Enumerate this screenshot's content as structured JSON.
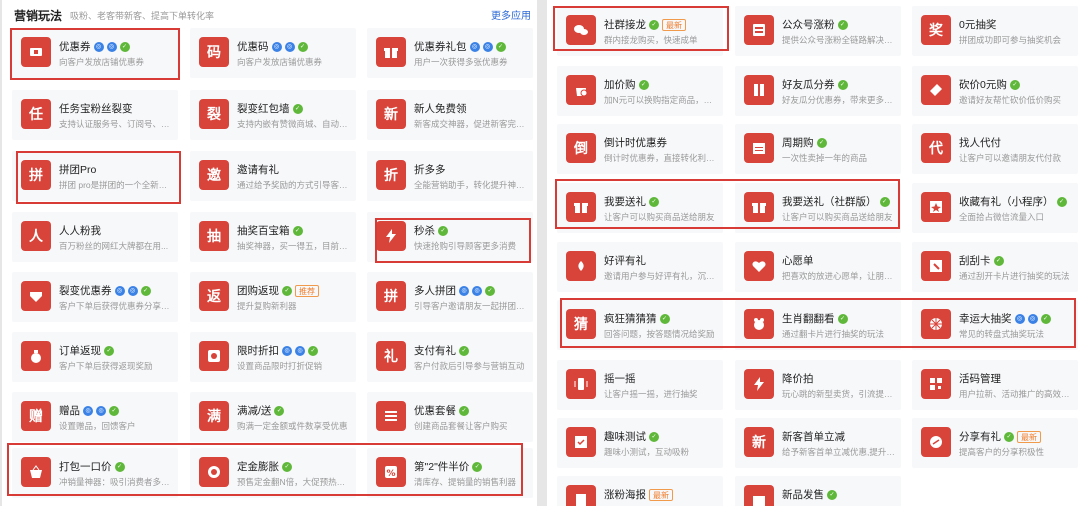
{
  "left": {
    "title": "营销玩法",
    "subtitle": "吸粉、老客带新客、提高下单转化率",
    "more": "更多应用",
    "cards": [
      {
        "name": "优惠券",
        "desc": "向客户发放店铺优惠券",
        "icon": "ticket-icon",
        "glyph": "",
        "badges": [
          "blue",
          "blue",
          "green"
        ],
        "tag": ""
      },
      {
        "name": "优惠码",
        "desc": "向客户发放店铺优惠券",
        "icon": "code-icon",
        "glyph": "码",
        "badges": [
          "blue",
          "blue",
          "green"
        ],
        "tag": ""
      },
      {
        "name": "优惠券礼包",
        "desc": "用户一次获得多张优惠券",
        "icon": "gift-pack-icon",
        "glyph": "",
        "badges": [
          "blue",
          "blue",
          "green"
        ],
        "tag": ""
      },
      {
        "name": "任务宝粉丝裂变",
        "desc": "支持认证服务号、订阅号、微...",
        "icon": "task-icon",
        "glyph": "任",
        "badges": [],
        "tag": ""
      },
      {
        "name": "裂变红包墙",
        "desc": "支持内嵌有赞微商城、自动下...",
        "icon": "fission-icon",
        "glyph": "裂",
        "badges": [
          "green"
        ],
        "tag": ""
      },
      {
        "name": "新人免费领",
        "desc": "新客成交神器，促进新客完成...",
        "icon": "newcomer-icon",
        "glyph": "新",
        "badges": [],
        "tag": ""
      },
      {
        "name": "拼团Pro",
        "desc": "拼团 pro是拼团的一个全新的...",
        "icon": "group-buy-icon",
        "glyph": "拼",
        "badges": [],
        "tag": ""
      },
      {
        "name": "邀请有礼",
        "desc": "通过给予奖励的方式引导客户...",
        "icon": "invite-icon",
        "glyph": "邀",
        "badges": [],
        "tag": ""
      },
      {
        "name": "折多多",
        "desc": "全能营销助手，转化提升神器...",
        "icon": "discount-icon",
        "glyph": "折",
        "badges": [],
        "tag": ""
      },
      {
        "name": "人人粉我",
        "desc": "百万粉丝的网红大牌都在用...",
        "icon": "people-icon",
        "glyph": "人",
        "badges": [],
        "tag": ""
      },
      {
        "name": "抽奖百宝箱",
        "desc": "抽奖神器，买一得五，目前已...",
        "icon": "lottery-box-icon",
        "glyph": "抽",
        "badges": [
          "green"
        ],
        "tag": ""
      },
      {
        "name": "秒杀",
        "desc": "快速抢购引导顾客更多消费",
        "icon": "flash-icon",
        "glyph": "",
        "badges": [
          "green"
        ],
        "tag": ""
      },
      {
        "name": "裂变优惠券",
        "desc": "客户下单后获得优惠券分享给...",
        "icon": "fission-coupon-icon",
        "glyph": "",
        "badges": [
          "blue",
          "blue",
          "green"
        ],
        "tag": ""
      },
      {
        "name": "团购返现",
        "desc": "提升复购新利器",
        "icon": "cashback-icon",
        "glyph": "返",
        "badges": [
          "green"
        ],
        "tag": "推荐"
      },
      {
        "name": "多人拼团",
        "desc": "引导客户邀请朋友一起拼团购买",
        "icon": "multi-group-icon",
        "glyph": "拼",
        "badges": [
          "blue",
          "blue",
          "green"
        ],
        "tag": ""
      },
      {
        "name": "订单返现",
        "desc": "客户下单后获得返现奖励",
        "icon": "money-bag-icon",
        "glyph": "",
        "badges": [
          "green"
        ],
        "tag": ""
      },
      {
        "name": "限时折扣",
        "desc": "设置商品限时打折促销",
        "icon": "clock-icon",
        "glyph": "",
        "badges": [
          "blue",
          "blue",
          "green"
        ],
        "tag": ""
      },
      {
        "name": "支付有礼",
        "desc": "客户付款后引导参与营销互动",
        "icon": "pay-gift-icon",
        "glyph": "礼",
        "badges": [
          "green"
        ],
        "tag": ""
      },
      {
        "name": "赠品",
        "desc": "设置赠品，回馈客户",
        "icon": "gift-icon",
        "glyph": "赠",
        "badges": [
          "blue",
          "blue",
          "green"
        ],
        "tag": ""
      },
      {
        "name": "满减/送",
        "desc": "购满一定金额或件数享受优惠",
        "icon": "full-reduce-icon",
        "glyph": "满",
        "badges": [
          "green"
        ],
        "tag": ""
      },
      {
        "name": "优惠套餐",
        "desc": "创建商品套餐让客户购买",
        "icon": "package-icon",
        "glyph": "",
        "badges": [
          "green"
        ],
        "tag": ""
      },
      {
        "name": "打包一口价",
        "desc": "冲销量神器：吸引消费者多买...",
        "icon": "basket-icon",
        "glyph": "",
        "badges": [
          "green"
        ],
        "tag": ""
      },
      {
        "name": "定金膨胀",
        "desc": "预售定金翻N倍，大促预热利器",
        "icon": "deposit-icon",
        "glyph": "",
        "badges": [
          "green"
        ],
        "tag": ""
      },
      {
        "name": "第\"2\"件半价",
        "desc": "清库存、提销量的销售利器",
        "icon": "percent-icon",
        "glyph": "",
        "badges": [
          "green"
        ],
        "tag": ""
      }
    ]
  },
  "right": {
    "cards": [
      {
        "name": "社群接龙",
        "desc": "群内接龙购买，快速成单",
        "icon": "chat-icon",
        "glyph": "",
        "badges": [
          "green"
        ],
        "tag": "最新"
      },
      {
        "name": "公众号涨粉",
        "desc": "提供公众号涨粉全链路解决方案",
        "icon": "official-account-icon",
        "glyph": "",
        "badges": [
          "green"
        ],
        "tag": ""
      },
      {
        "name": "0元抽奖",
        "desc": "拼团成功即可参与抽奖机会",
        "icon": "prize-icon",
        "glyph": "奖",
        "badges": [],
        "tag": ""
      },
      {
        "name": "加价购",
        "desc": "加N元可以换购指定商品，提...",
        "icon": "add-price-icon",
        "glyph": "",
        "badges": [
          "green"
        ],
        "tag": ""
      },
      {
        "name": "好友瓜分券",
        "desc": "好友瓜分优惠券，带来更多流量",
        "icon": "share-coupon-icon",
        "glyph": "",
        "badges": [
          "green"
        ],
        "tag": ""
      },
      {
        "name": "砍价0元购",
        "desc": "邀请好友帮忙砍价低价购买",
        "icon": "bargain-icon",
        "glyph": "",
        "badges": [
          "green"
        ],
        "tag": ""
      },
      {
        "name": "倒计时优惠券",
        "desc": "倒计时优惠券，直接转化利器...",
        "icon": "countdown-icon",
        "glyph": "倒",
        "badges": [],
        "tag": ""
      },
      {
        "name": "周期购",
        "desc": "一次性卖掉一年的商品",
        "icon": "calendar-icon",
        "glyph": "",
        "badges": [
          "green"
        ],
        "tag": ""
      },
      {
        "name": "找人代付",
        "desc": "让客户可以邀请朋友代付款",
        "icon": "proxy-pay-icon",
        "glyph": "代",
        "badges": [],
        "tag": ""
      },
      {
        "name": "我要送礼",
        "desc": "让客户可以购买商品送给朋友",
        "icon": "present-icon",
        "glyph": "",
        "badges": [
          "green"
        ],
        "tag": ""
      },
      {
        "name": "我要送礼（社群版）",
        "desc": "让客户可以购买商品送给朋友",
        "icon": "present-group-icon",
        "glyph": "",
        "badges": [
          "green"
        ],
        "tag": ""
      },
      {
        "name": "收藏有礼（小程序）",
        "desc": "全面拾占微信流量入口",
        "icon": "favorite-icon",
        "glyph": "",
        "badges": [
          "green"
        ],
        "tag": ""
      },
      {
        "name": "好评有礼",
        "desc": "邀请用户参与好评有礼，沉淀...",
        "icon": "flower-icon",
        "glyph": "",
        "badges": [],
        "tag": ""
      },
      {
        "name": "心愿单",
        "desc": "把喜欢的放进心愿单，让朋友...",
        "icon": "heart-icon",
        "glyph": "",
        "badges": [],
        "tag": ""
      },
      {
        "name": "刮刮卡",
        "desc": "通过刮开卡片进行抽奖的玩法",
        "icon": "scratch-card-icon",
        "glyph": "",
        "badges": [
          "green"
        ],
        "tag": ""
      },
      {
        "name": "疯狂猜猜猜",
        "desc": "回答问题，按答题情况给奖励",
        "icon": "guess-icon",
        "glyph": "猜",
        "badges": [
          "green"
        ],
        "tag": ""
      },
      {
        "name": "生肖翻翻看",
        "desc": "通过翻卡片进行抽奖的玩法",
        "icon": "zodiac-icon",
        "glyph": "",
        "badges": [
          "green"
        ],
        "tag": ""
      },
      {
        "name": "幸运大抽奖",
        "desc": "常见的转盘式抽奖玩法",
        "icon": "wheel-icon",
        "glyph": "",
        "badges": [
          "blue",
          "blue",
          "green"
        ],
        "tag": ""
      },
      {
        "name": "摇一摇",
        "desc": "让客户摇一摇，进行抽奖",
        "icon": "phone-shake-icon",
        "glyph": "",
        "badges": [],
        "tag": ""
      },
      {
        "name": "降价拍",
        "desc": "玩心跳的新型卖货，引流提销量",
        "icon": "lightning-icon",
        "glyph": "",
        "badges": [],
        "tag": ""
      },
      {
        "name": "活码管理",
        "desc": "用户拉新、活动推广的高效引...",
        "icon": "qrcode-icon",
        "glyph": "",
        "badges": [],
        "tag": ""
      },
      {
        "name": "趣味测试",
        "desc": "趣味小测试，互动吸粉",
        "icon": "quiz-icon",
        "glyph": "",
        "badges": [
          "green"
        ],
        "tag": ""
      },
      {
        "name": "新客首单立减",
        "desc": "给予新客首单立减优惠,提升新...",
        "icon": "new-order-icon",
        "glyph": "新",
        "badges": [],
        "tag": ""
      },
      {
        "name": "分享有礼",
        "desc": "提高客户的分享积极性",
        "icon": "share-icon",
        "glyph": "",
        "badges": [
          "green"
        ],
        "tag": "最新"
      },
      {
        "name": "涨粉海报",
        "desc": "",
        "icon": "poster-icon",
        "glyph": "",
        "badges": [],
        "tag": "最新"
      },
      {
        "name": "新品发售",
        "desc": "",
        "icon": "new-product-icon",
        "glyph": "",
        "badges": [
          "green"
        ],
        "tag": ""
      }
    ]
  }
}
